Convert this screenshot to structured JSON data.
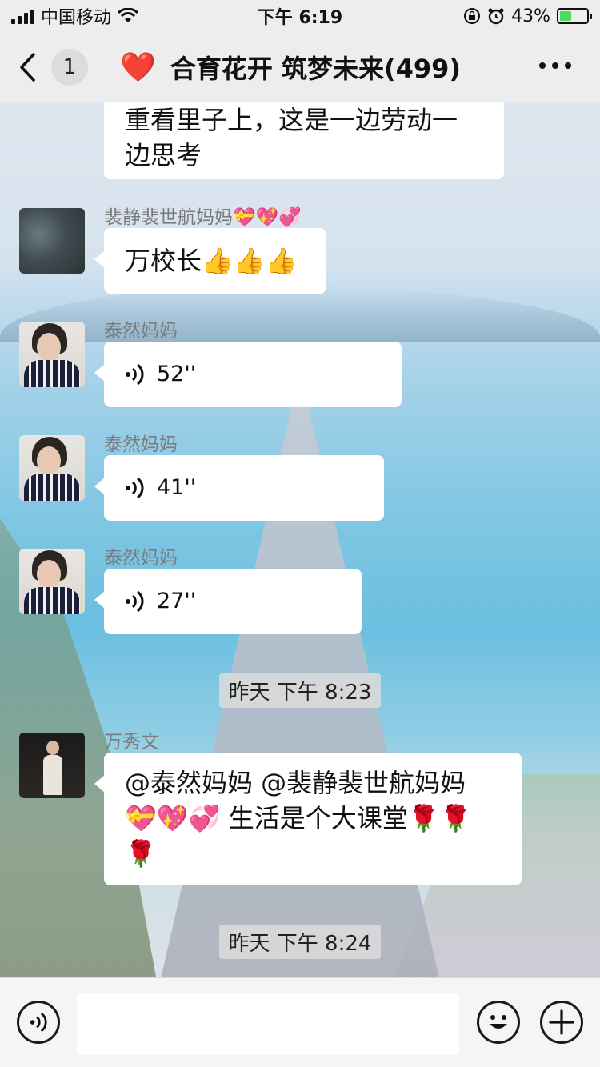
{
  "status_bar": {
    "carrier": "中国移动",
    "time": "下午 6:19",
    "battery": "43%",
    "battery_level": 0.43
  },
  "header": {
    "back_count": "1",
    "emoji": "❤️",
    "title": "合育花开 筑梦未来(499)"
  },
  "messages": [
    {
      "type": "text",
      "continued": true,
      "text": "重看里子上，这是一边劳动一边思考"
    },
    {
      "type": "text",
      "sender": "裴静裴世航妈妈💝💖💞",
      "text": "万校长👍👍👍"
    },
    {
      "type": "voice",
      "sender": "泰然妈妈",
      "duration": "52''"
    },
    {
      "type": "voice",
      "sender": "泰然妈妈",
      "duration": "41''"
    },
    {
      "type": "voice",
      "sender": "泰然妈妈",
      "duration": "27''"
    },
    {
      "type": "time",
      "text": "昨天 下午 8:23"
    },
    {
      "type": "text",
      "sender": "万秀文",
      "text": "@泰然妈妈 @裴静裴世航妈妈💝💖💞 生活是个大课堂🌹🌹🌹"
    },
    {
      "type": "time",
      "text": "昨天 下午 8:24"
    }
  ],
  "display": {
    "msg0_line1": "重看里子上，这是一边劳动一",
    "msg0_line2": "边思考",
    "msg6_line1": "@泰然妈妈 @裴静裴世航妈妈",
    "msg6_line2": "💝💖💞 生活是个大课堂🌹🌹",
    "msg6_line3": "🌹"
  },
  "input": {
    "placeholder": ""
  },
  "icons": [
    "signal-icon",
    "wifi-icon",
    "lock-rotation-icon",
    "alarm-icon",
    "battery-icon",
    "back-chevron-icon",
    "more-icon",
    "voice-wave-icon",
    "emoji-icon",
    "plus-icon"
  ],
  "colors": {
    "bubble": "#ffffff",
    "bar": "#ededed",
    "heart": "#e53935",
    "battery_fill": "#4cd964"
  }
}
